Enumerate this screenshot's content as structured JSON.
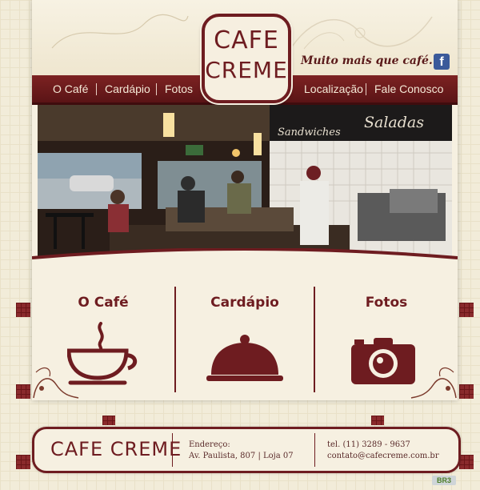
{
  "brand": {
    "logo_line1": "CAFE",
    "logo_line2": "CREME",
    "slogan": "Muito mais que café."
  },
  "nav": {
    "left": [
      "O Café",
      "Cardápio",
      "Fotos"
    ],
    "right": [
      "Localização",
      "Fale Conosco"
    ]
  },
  "social": {
    "facebook_glyph": "f",
    "icon": "facebook-icon"
  },
  "photo": {
    "sign_left": "Sandwiches",
    "sign_right": "Saladas"
  },
  "features": [
    {
      "title": "O Café",
      "icon": "coffee-cup-icon"
    },
    {
      "title": "Cardápio",
      "icon": "cloche-icon"
    },
    {
      "title": "Fotos",
      "icon": "camera-icon"
    }
  ],
  "footer": {
    "logo": "CAFE CREME",
    "address_label": "Endereço:",
    "address": "Av. Paulista, 807 | Loja 07",
    "phone": "tel. (11) 3289 - 9637",
    "email": "contato@cafecreme.com.br"
  },
  "badge": "BR3",
  "colors": {
    "brand": "#6e1c20",
    "nav_bg": "#7d2222",
    "cream": "#f6f0e1"
  }
}
